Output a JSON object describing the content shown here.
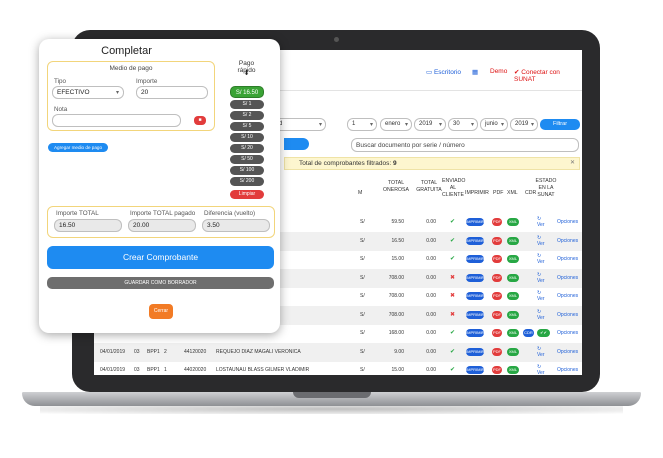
{
  "topbar": {
    "escritorio": "Escritorio",
    "demo": "Demo",
    "conectar": "Conectar con SUNAT"
  },
  "filters": {
    "partial_left": "d",
    "day_from": "1",
    "month_from": "enero",
    "year_from": "2019",
    "day_to": "30",
    "month_to": "junio",
    "year_to": "2019",
    "filtrar": "Filtrar",
    "search_placeholder": "Buscar documento por serie / número"
  },
  "alert": {
    "text": "Total de comprobantes filtrados:",
    "count": "9"
  },
  "table": {
    "headers": {
      "m": "M",
      "total_onerosa": "TOTAL ONEROSA",
      "total_gratuita": "TOTAL GRATUITA",
      "envio": "ENVIADO AL CLIENTE",
      "imprimir": "IMPRIMIR",
      "pdf": "PDF",
      "xml": "XML",
      "cdr": "CDR",
      "estado": "ESTADO EN LA SUNAT"
    },
    "rows": [
      {
        "m": "S/",
        "onerosa": "59.50",
        "gratuita": "0.00",
        "envio": "ok"
      },
      {
        "m": "S/",
        "onerosa": "16.50",
        "gratuita": "0.00",
        "envio": "ok"
      },
      {
        "m": "S/",
        "onerosa": "15.00",
        "gratuita": "0.00",
        "envio": "ok"
      },
      {
        "m": "S/",
        "onerosa": "708.00",
        "gratuita": "0.00",
        "envio": "no"
      },
      {
        "m": "S/",
        "onerosa": "708.00",
        "gratuita": "0.00",
        "envio": "no"
      },
      {
        "m": "S/",
        "onerosa": "708.00",
        "gratuita": "0.00",
        "envio": "no"
      },
      {
        "m": "S/",
        "onerosa": "168.00",
        "gratuita": "0.00",
        "envio": "ok"
      },
      {
        "fecha": "04/01/2019",
        "tipo": "03",
        "serie": "BPP1",
        "num": "2",
        "doc": "44120020",
        "cliente": "REQUEJO DIAZ MAGALI VERONICA",
        "m": "S/",
        "onerosa": "9.00",
        "gratuita": "0.00",
        "envio": "ok"
      },
      {
        "fecha": "04/01/2019",
        "tipo": "03",
        "serie": "BPP1",
        "num": "1",
        "doc": "44020020",
        "cliente": "LOSTAUNAU BLASS GILMER VLADIMIR",
        "m": "S/",
        "onerosa": "15.00",
        "gratuita": "0.00",
        "envio": "ok"
      }
    ],
    "imprimir_label": "IMPRIMIR",
    "pdf_label": "PDF",
    "xml_label": "XML",
    "cdr_label": "CDR",
    "ver_label": "Ver",
    "opciones_label": "Opciones"
  },
  "modal": {
    "title": "Completar",
    "medio_title": "Medio de pago",
    "tipo_label": "Tipo",
    "tipo_value": "EFECTIVO",
    "importe_label": "Importe",
    "importe_value": "20",
    "nota_label": "Nota",
    "agregar": "Agregar medio de pago",
    "pago_rapido_title": "Pago rápido",
    "pago_rapido_arrow": "⬇",
    "quick_main": "S/ 16.50",
    "quick": [
      "S/ 1",
      "S/ 2",
      "S/ 5",
      "S/ 10",
      "S/ 20",
      "S/ 50",
      "S/ 100",
      "S/ 200"
    ],
    "limpiar": "Limpiar",
    "importe_total_label": "Importe TOTAL",
    "importe_total_value": "16.50",
    "importe_pagado_label": "Importe TOTAL pagado",
    "importe_pagado_value": "20.00",
    "diferencia_label": "Diferencia (vuelto)",
    "diferencia_value": "3.50",
    "crear": "Crear Comprobante",
    "borrador": "GUARDAR COMO BORRADOR",
    "cerrar": "Cerrar"
  },
  "colors": {
    "primary": "#1e8bf1",
    "success": "#27a744",
    "danger": "#e23c3c",
    "warning": "#f27b25"
  },
  "icons": {
    "escritorio": "monitor-icon",
    "calc": "calculator-icon",
    "conectar": "check-icon",
    "delete": "trash-icon",
    "close": "close-icon"
  }
}
